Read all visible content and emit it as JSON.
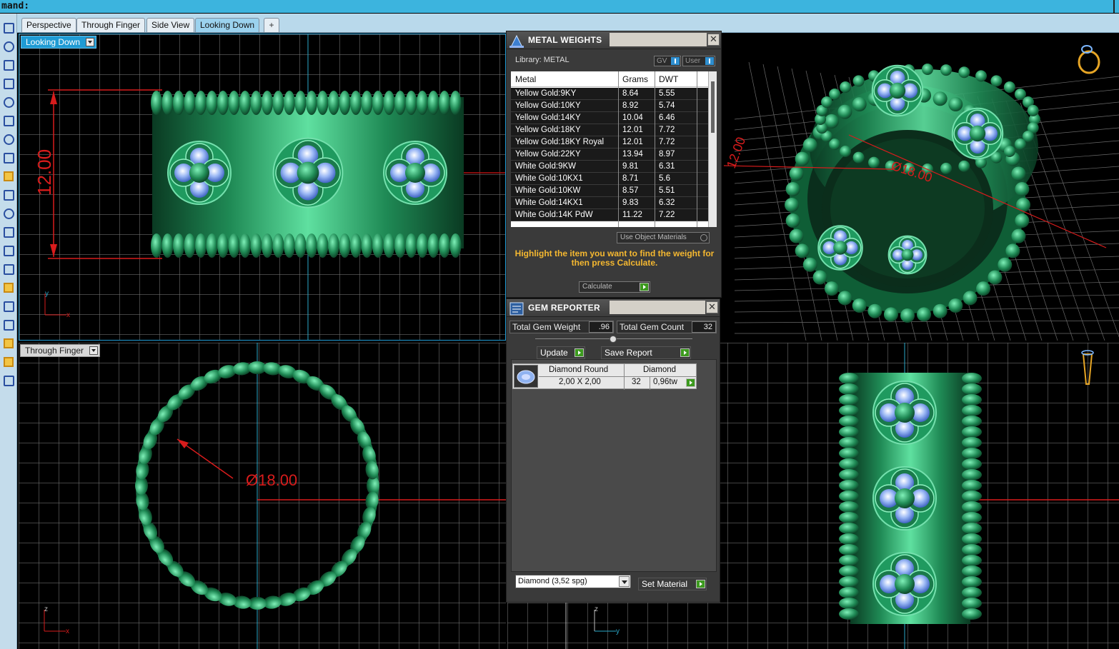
{
  "command_bar": {
    "text": "mand:"
  },
  "tabs": [
    {
      "label": "Perspective",
      "active": false
    },
    {
      "label": "Through Finger",
      "active": false
    },
    {
      "label": "Side View",
      "active": false
    },
    {
      "label": "Looking Down",
      "active": true
    }
  ],
  "tab_add_icon": "plus-icon",
  "viewports": {
    "top_left": {
      "label": "Looking Down",
      "dimension_text": "12.00",
      "axis_x": "x",
      "axis_y": "y"
    },
    "top_right": {
      "dimension_height": "12.00",
      "dimension_diameter": "Ø18.00",
      "icon": "ring-icon"
    },
    "bottom_left": {
      "label": "Through Finger",
      "dimension_text": "Ø18.00",
      "axis_x": "x",
      "axis_z": "z"
    },
    "bottom_right": {
      "axis_y": "y",
      "axis_z": "z",
      "icon": "finger-icon"
    }
  },
  "metal_weights": {
    "title": "METAL WEIGHTS",
    "library_label": "Library: METAL",
    "toggle_gv": "GV",
    "toggle_user": "User",
    "columns": [
      "Metal",
      "Grams",
      "DWT"
    ],
    "rows": [
      [
        "Yellow Gold:9KY",
        "8.64",
        "5.55"
      ],
      [
        "Yellow Gold:10KY",
        "8.92",
        "5.74"
      ],
      [
        "Yellow Gold:14KY",
        "10.04",
        "6.46"
      ],
      [
        "Yellow Gold:18KY",
        "12.01",
        "7.72"
      ],
      [
        "Yellow Gold:18KY Royal",
        "12.01",
        "7.72"
      ],
      [
        "Yellow Gold:22KY",
        "13.94",
        "8.97"
      ],
      [
        "White Gold:9KW",
        "9.81",
        "6.31"
      ],
      [
        "White Gold:10KX1",
        "8.71",
        "5.6"
      ],
      [
        "White Gold:10KW",
        "8.57",
        "5.51"
      ],
      [
        "White Gold:14KX1",
        "9.83",
        "6.32"
      ],
      [
        "White Gold:14K PdW",
        "11.22",
        "7.22"
      ]
    ],
    "use_object_materials": "Use Object Materials",
    "hint": "Highlight the item you want to find the weight for then press Calculate.",
    "calculate_label": "Calculate"
  },
  "gem_reporter": {
    "title": "GEM REPORTER",
    "total_weight_label": "Total Gem Weight",
    "total_weight_value": ".96",
    "total_count_label": "Total Gem Count",
    "total_count_value": "32",
    "update_label": "Update",
    "save_report_label": "Save Report",
    "gems": [
      {
        "cut": "Diamond Round",
        "type": "Diamond",
        "size": "2,00 X 2,00",
        "count": "32",
        "weight": "0,96tw"
      }
    ],
    "material_select": "Diamond     (3,52 spg)",
    "set_material_label": "Set Material"
  },
  "colors": {
    "accent_blue": "#1f9bd4",
    "command_bar": "#3cb4de",
    "ring_green": "#1f8a55",
    "gem_blue": "#8fb2f0",
    "dimension_red": "#d81c1c",
    "hint_orange": "#f5b830"
  }
}
